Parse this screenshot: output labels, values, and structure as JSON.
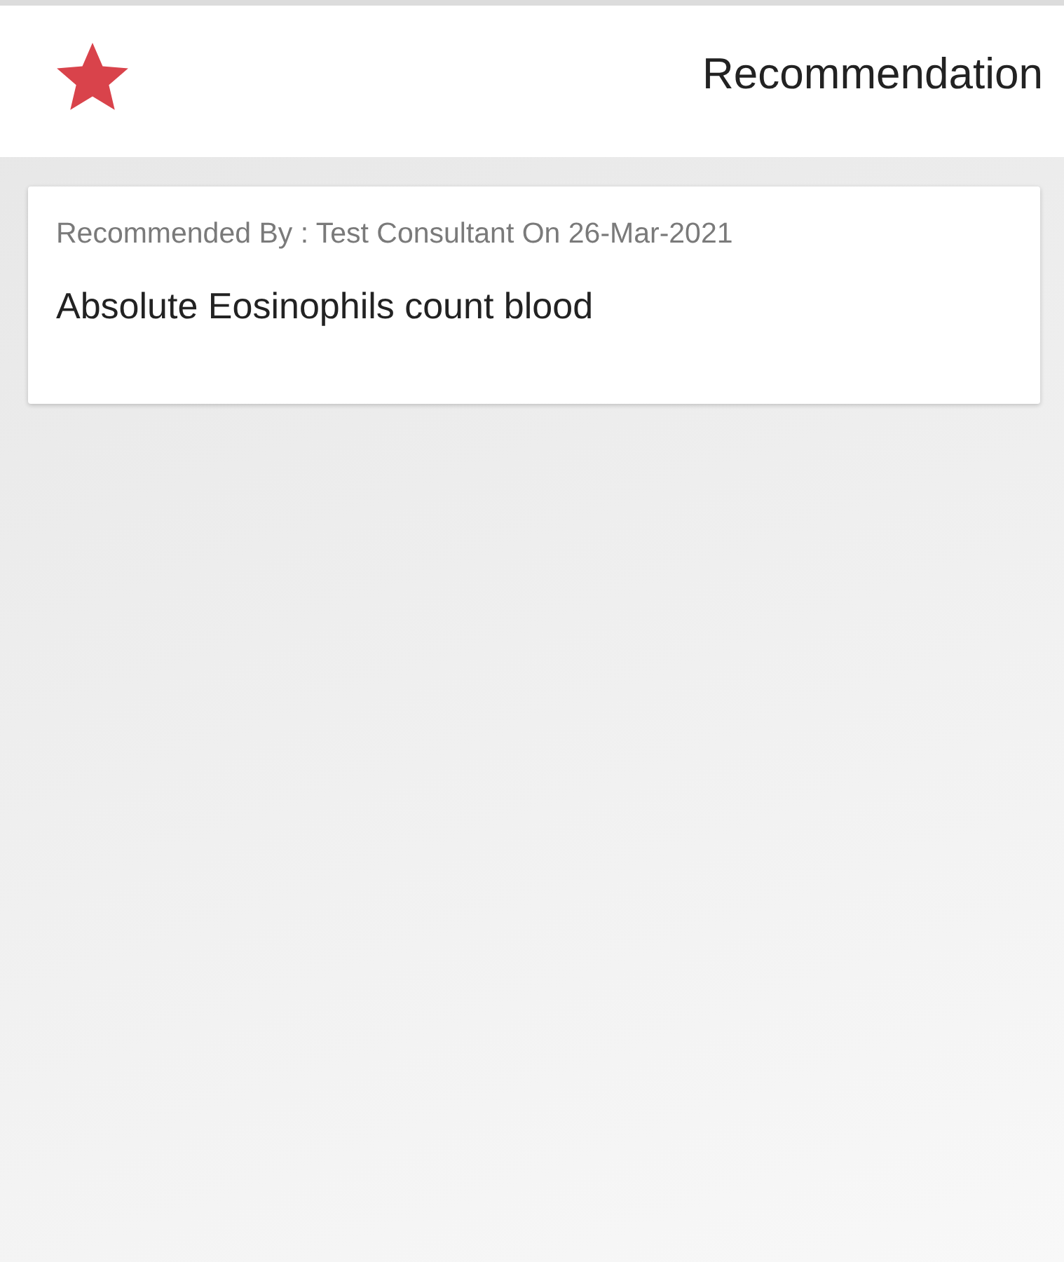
{
  "header": {
    "title": "Recommendation"
  },
  "recommendations": [
    {
      "meta": "Recommended By : Test Consultant On 26-Mar-2021",
      "name": "Absolute Eosinophils count blood"
    }
  ]
}
